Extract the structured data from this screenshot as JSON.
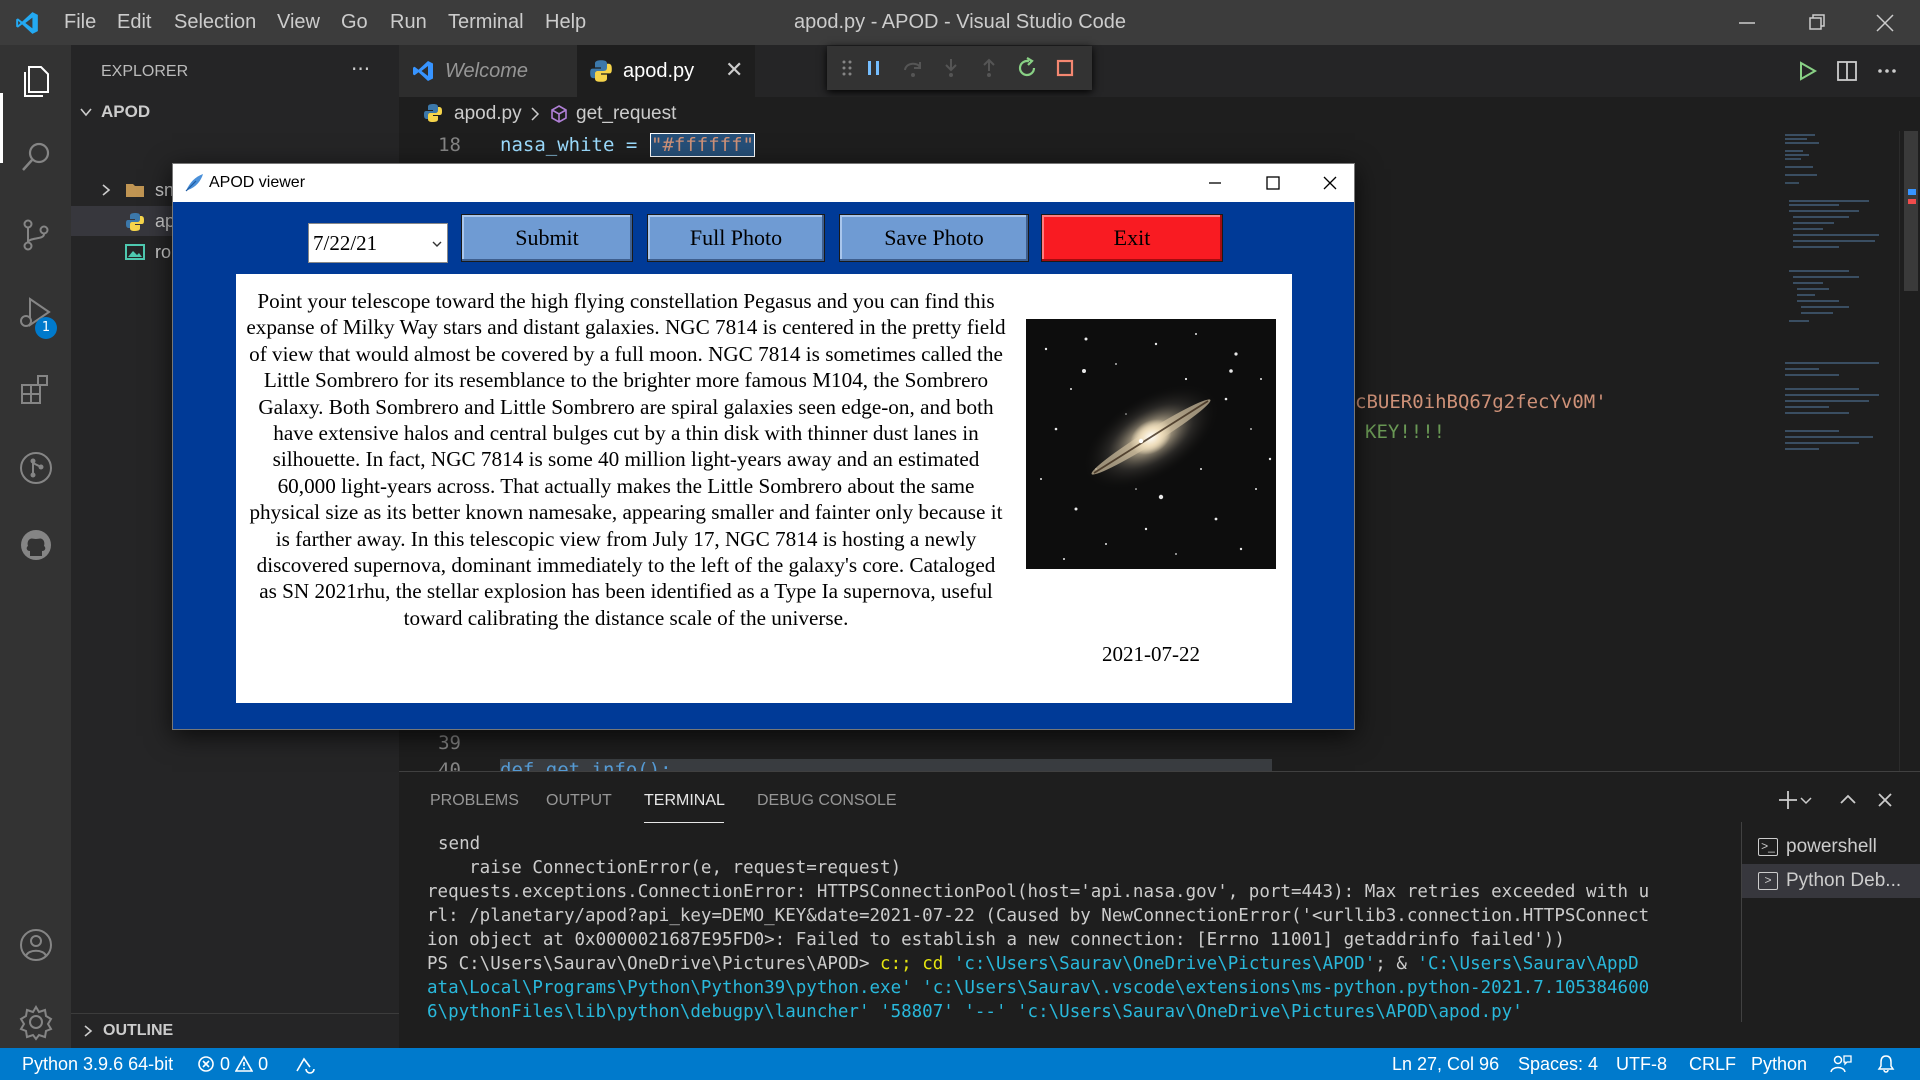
{
  "titlebar": {
    "menu": [
      "File",
      "Edit",
      "Selection",
      "View",
      "Go",
      "Run",
      "Terminal",
      "Help"
    ],
    "title": "apod.py - APOD - Visual Studio Code"
  },
  "activitybar": {
    "items": [
      "files-icon",
      "search-icon",
      "source-control-icon",
      "run-debug-icon",
      "extensions-icon",
      "git-graph-icon",
      "github-icon",
      "account-icon",
      "settings-gear-icon"
    ],
    "debug_badge": "1"
  },
  "sidebar": {
    "title": "EXPLORER",
    "more": "···",
    "root": "APOD",
    "items": [
      {
        "label": "snaps",
        "type": "folder"
      },
      {
        "label": "ap",
        "type": "python-file"
      },
      {
        "label": "ro",
        "type": "image-file"
      }
    ],
    "outline": "OUTLINE"
  },
  "tabs": [
    {
      "label": "Welcome"
    },
    {
      "label": "apod.py",
      "active": true
    }
  ],
  "breadcrumb": {
    "file": "apod.py",
    "symbol": "get_request"
  },
  "editor": {
    "line_18_num": "18",
    "line_18_code": "nasa_white = ",
    "line_18_string": "\"#ffffff\"",
    "api_key_fragment": "cBUER0ihBQ67g2fecYv0M'",
    "comment_fragment": "KEY!!!!",
    "line_39_num": "39",
    "line_40_num": "40",
    "line_40_code": "def get_info():"
  },
  "panel": {
    "tabs": [
      "PROBLEMS",
      "OUTPUT",
      "TERMINAL",
      "DEBUG CONSOLE"
    ],
    "active_tab": "TERMINAL",
    "terminal_lines": [
      "send",
      "    raise ConnectionError(e, request=request)",
      "requests.exceptions.ConnectionError: HTTPSConnectionPool(host='api.nasa.gov', port=443): Max retries exceeded with u",
      "rl: /planetary/apod?api_key=DEMO_KEY&date=2021-07-22 (Caused by NewConnectionError('<urllib3.connection.HTTPSConnect",
      "ion object at 0x0000021687E95FD0>: Failed to establish a new connection: [Errno 11001] getaddrinfo failed'))"
    ],
    "prompt": "PS C:\\Users\\Saurav\\OneDrive\\Pictures\\APOD>",
    "cmd1": " c:; ",
    "cmd2": "cd ",
    "path1": "'c:\\Users\\Saurav\\OneDrive\\Pictures\\APOD'",
    "amp": "; & ",
    "cont_line_1_head": "'C:\\Users\\Saurav\\AppD",
    "cont_line_2": "ata\\Local\\Programs\\Python\\Python39\\python.exe' 'c:\\Users\\Saurav\\.vscode\\extensions\\ms-python.python-2021.7.105384600",
    "cont_line_3": "6\\pythonFiles\\lib\\python\\debugpy\\launcher' '58807' '--' 'c:\\Users\\Saurav\\OneDrive\\Pictures\\APOD\\apod.py'",
    "terminals": [
      "powershell",
      "Python Deb..."
    ]
  },
  "statusbar": {
    "interpreter": "Python 3.9.6 64-bit",
    "errors": "0",
    "warnings": "0",
    "position": "Ln 27, Col 96",
    "spaces": "Spaces: 4",
    "encoding": "UTF-8",
    "eol": "CRLF",
    "language": "Python"
  },
  "apod_window": {
    "title": "APOD viewer",
    "date_value": "7/22/21",
    "buttons": {
      "submit": "Submit",
      "full_photo": "Full Photo",
      "save_photo": "Save Photo",
      "exit": "Exit"
    },
    "description": "Point your telescope toward the high flying constellation Pegasus and you can find this expanse of Milky Way stars and distant galaxies. NGC 7814 is centered in the pretty field of view that would almost be covered by a full moon. NGC 7814 is sometimes called the Little Sombrero for its resemblance to the brighter more famous M104, the Sombrero Galaxy. Both Sombrero and Little Sombrero are spiral galaxies seen edge-on, and both have extensive halos and central bulges cut by a thin disk with thinner dust lanes in silhouette. In fact, NGC 7814 is some 40 million light-years away and an estimated 60,000 light-years across. That actually makes the Little Sombrero about the same physical size as its better known namesake, appearing smaller and fainter only because it is farther away. In this telescopic view from July 17, NGC 7814 is hosting a newly discovered supernova, dominant immediately to the left of the galaxy's core. Cataloged as SN 2021rhu, the stellar explosion has been identified as a Type Ia supernova, useful toward calibrating the distance scale of the universe.",
    "photo_date": "2021-07-22",
    "colors": {
      "background": "#003a97",
      "button": "#6f9bd3",
      "exit": "#f91b22"
    }
  },
  "colors": {
    "accent": "#007acc",
    "titlebar": "#3c3c3c",
    "activitybar": "#333333",
    "sidebar": "#252526",
    "editor": "#1e1e1e"
  }
}
